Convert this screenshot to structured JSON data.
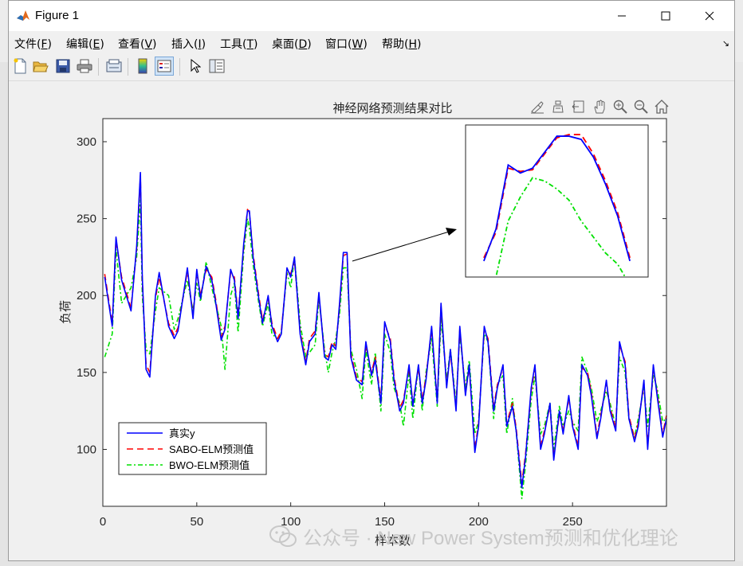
{
  "window": {
    "title": "Figure 1",
    "controls": [
      "minimize-icon",
      "maximize-icon",
      "close-icon"
    ]
  },
  "menu": [
    {
      "label": "文件(",
      "key": "F",
      "end": ")"
    },
    {
      "label": "编辑(",
      "key": "E",
      "end": ")"
    },
    {
      "label": "查看(",
      "key": "V",
      "end": ")"
    },
    {
      "label": "插入(",
      "key": "I",
      "end": ")"
    },
    {
      "label": "工具(",
      "key": "T",
      "end": ")"
    },
    {
      "label": "桌面(",
      "key": "D",
      "end": ")"
    },
    {
      "label": "窗口(",
      "key": "W",
      "end": ")"
    },
    {
      "label": "帮助(",
      "key": "H",
      "end": ")"
    }
  ],
  "toolbar": [
    "new-figure-icon",
    "open-file-icon",
    "save-icon",
    "print-icon",
    "link-plot-icon",
    "insert-colorbar-icon",
    "insert-legend-icon",
    "select-arrow-icon",
    "property-inspector-icon"
  ],
  "axes_toolbar": [
    "brush-icon",
    "data-tips-icon",
    "restore-view-icon",
    "pan-icon",
    "zoom-in-icon",
    "zoom-out-icon",
    "home-icon"
  ],
  "watermark": {
    "text": "公众号 · New Power System预测和优化理论"
  },
  "colors": {
    "real": "#0000ff",
    "sabo": "#ff0000",
    "bwo": "#00e000"
  },
  "chart_data": {
    "type": "line",
    "title": "神经网络预测结果对比",
    "xlabel": "样本数",
    "ylabel": "负荷",
    "xlim": [
      0,
      300
    ],
    "ylim": [
      63,
      315
    ],
    "xticks": [
      0,
      50,
      100,
      150,
      200,
      250
    ],
    "yticks": [
      100,
      150,
      200,
      250,
      300
    ],
    "grid": false,
    "legend_position": "bottom-left",
    "x": [
      1,
      5,
      7,
      10,
      15,
      18,
      20,
      21,
      23,
      25,
      28,
      30,
      35,
      38,
      40,
      45,
      48,
      50,
      52,
      55,
      58,
      60,
      63,
      65,
      68,
      70,
      72,
      75,
      77,
      78,
      80,
      83,
      85,
      88,
      90,
      93,
      95,
      98,
      100,
      102,
      105,
      108,
      110,
      113,
      115,
      118,
      120,
      122,
      124,
      126,
      128,
      130,
      132,
      135,
      138,
      140,
      143,
      145,
      148,
      150,
      153,
      155,
      158,
      160,
      163,
      165,
      168,
      170,
      172,
      175,
      178,
      180,
      183,
      185,
      188,
      190,
      193,
      195,
      198,
      200,
      203,
      205,
      208,
      210,
      213,
      215,
      218,
      220,
      223,
      225,
      228,
      230,
      233,
      235,
      238,
      240,
      243,
      245,
      248,
      250,
      253,
      255,
      258,
      260,
      263,
      265,
      268,
      270,
      273,
      275,
      278,
      280,
      283,
      285,
      288,
      290,
      293,
      295,
      298,
      300
    ],
    "series": [
      {
        "name": "真实y",
        "values": [
          212,
          180,
          238,
          210,
          190,
          232,
          280,
          212,
          152,
          147,
          200,
          215,
          180,
          172,
          177,
          218,
          185,
          217,
          198,
          219,
          210,
          196,
          171,
          178,
          217,
          210,
          185,
          234,
          255,
          255,
          225,
          198,
          182,
          200,
          180,
          170,
          175,
          218,
          212,
          225,
          175,
          155,
          170,
          175,
          202,
          160,
          158,
          168,
          165,
          195,
          228,
          228,
          160,
          145,
          142,
          170,
          148,
          158,
          130,
          183,
          170,
          145,
          125,
          130,
          155,
          128,
          155,
          130,
          145,
          180,
          130,
          195,
          140,
          165,
          125,
          180,
          135,
          155,
          98,
          115,
          180,
          170,
          125,
          140,
          155,
          115,
          128,
          112,
          75,
          95,
          140,
          155,
          100,
          110,
          130,
          93,
          125,
          110,
          135,
          115,
          100,
          155,
          148,
          135,
          107,
          120,
          145,
          125,
          112,
          170,
          155,
          120,
          105,
          115,
          145,
          100,
          155,
          135,
          108,
          120
        ],
        "hidden_in_legend": false
      },
      {
        "name": "SABO-ELM预测值",
        "values": [
          214,
          182,
          236,
          212,
          192,
          230,
          278,
          210,
          155,
          150,
          198,
          212,
          182,
          174,
          179,
          216,
          187,
          215,
          200,
          217,
          212,
          198,
          173,
          180,
          215,
          212,
          187,
          232,
          256,
          254,
          227,
          200,
          184,
          198,
          182,
          172,
          177,
          216,
          214,
          223,
          177,
          157,
          172,
          177,
          200,
          162,
          160,
          170,
          167,
          193,
          226,
          227,
          162,
          147,
          144,
          168,
          150,
          160,
          132,
          181,
          172,
          147,
          127,
          132,
          153,
          130,
          153,
          132,
          147,
          178,
          132,
          193,
          142,
          163,
          127,
          178,
          137,
          153,
          100,
          117,
          178,
          172,
          127,
          142,
          153,
          117,
          130,
          114,
          78,
          97,
          138,
          153,
          102,
          112,
          128,
          95,
          123,
          112,
          133,
          117,
          102,
          153,
          150,
          137,
          109,
          122,
          143,
          127,
          114,
          168,
          157,
          122,
          107,
          117,
          143,
          102,
          153,
          137,
          110,
          122
        ]
      },
      {
        "name": "BWO-ELM预测值",
        "values": [
          160,
          175,
          230,
          195,
          205,
          225,
          262,
          200,
          165,
          162,
          190,
          205,
          200,
          178,
          185,
          210,
          190,
          208,
          196,
          222,
          205,
          195,
          180,
          152,
          200,
          208,
          176,
          228,
          250,
          244,
          220,
          195,
          180,
          195,
          175,
          172,
          176,
          215,
          205,
          225,
          182,
          160,
          163,
          168,
          198,
          165,
          150,
          163,
          172,
          188,
          218,
          218,
          165,
          152,
          133,
          165,
          142,
          163,
          125,
          175,
          163,
          140,
          130,
          115,
          150,
          120,
          155,
          125,
          150,
          172,
          128,
          185,
          145,
          165,
          130,
          175,
          140,
          158,
          110,
          118,
          175,
          170,
          120,
          142,
          148,
          110,
          133,
          112,
          68,
          90,
          132,
          148,
          110,
          115,
          130,
          100,
          128,
          115,
          125,
          118,
          112,
          160,
          150,
          140,
          118,
          125,
          138,
          130,
          115,
          160,
          150,
          120,
          108,
          120,
          140,
          115,
          148,
          140,
          118,
          120
        ]
      }
    ],
    "inset": {
      "xlim": [
        215,
        245
      ],
      "ylim": [
        170,
        265
      ],
      "x": [
        218,
        220,
        222,
        224,
        226,
        228,
        230,
        232,
        234,
        236,
        238,
        240,
        242
      ],
      "series": [
        {
          "name": "真实y",
          "values": [
            180,
            200,
            240,
            235,
            238,
            248,
            258,
            258,
            256,
            245,
            228,
            208,
            180
          ]
        },
        {
          "name": "SABO-ELM预测值",
          "values": [
            182,
            198,
            238,
            236,
            237,
            247,
            257,
            259,
            259,
            247,
            230,
            210,
            182
          ]
        },
        {
          "name": "BWO-ELM预测值",
          "values": [
            160,
            170,
            205,
            220,
            232,
            230,
            225,
            218,
            205,
            195,
            185,
            178,
            165
          ]
        }
      ]
    }
  }
}
